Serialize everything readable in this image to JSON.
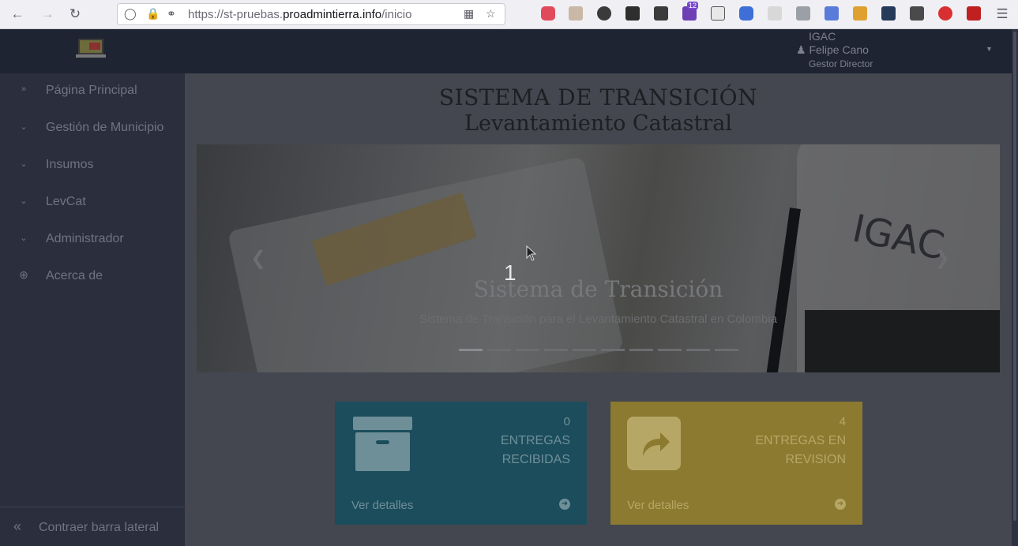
{
  "browser": {
    "url_prefix": "https://st-pruebas.",
    "url_domain": "proadmintierra.info",
    "url_path": "/inicio",
    "extension_badge": "12",
    "icons": [
      "back-icon",
      "forward-icon",
      "reload-icon",
      "shield-icon",
      "lock-icon",
      "key-icon",
      "grid-icon",
      "star-icon",
      "pocket-icon",
      "download-icon",
      "menu-icon"
    ]
  },
  "header": {
    "org": "IGAC",
    "user_name": "Felipe Cano",
    "user_role": "Gestor Director"
  },
  "sidebar": {
    "items": [
      {
        "label": "Página Principal",
        "icon": "double-chevron-right-icon"
      },
      {
        "label": "Gestión de Municipio",
        "icon": "double-chevron-down-icon"
      },
      {
        "label": "Insumos",
        "icon": "double-chevron-down-icon"
      },
      {
        "label": "LevCat",
        "icon": "double-chevron-down-icon"
      },
      {
        "label": "Administrador",
        "icon": "double-chevron-down-icon"
      },
      {
        "label": "Acerca de",
        "icon": "plus-circle-icon"
      }
    ],
    "collapse_label": "Contraer barra lateral"
  },
  "main": {
    "title": "SISTEMA DE TRANSICIÓN",
    "subtitle": "Levantamiento Catastral",
    "carousel": {
      "slide_number": "1",
      "caption_title": "Sistema de Transición",
      "caption_text": "Sistema de Transición para el Levantamiento Catastral en Colombia",
      "indicator_count": 10,
      "active_indicator": 0
    },
    "cards": [
      {
        "count": "0",
        "line1": "ENTREGAS",
        "line2": "RECIBIDAS",
        "link": "Ver detalles",
        "icon": "archive-box-icon",
        "color": "#1c4d5c"
      },
      {
        "count": "4",
        "line1": "ENTREGAS EN",
        "line2": "REVISION",
        "link": "Ver detalles",
        "icon": "share-arrow-icon",
        "color": "#8b7a2f"
      }
    ]
  }
}
